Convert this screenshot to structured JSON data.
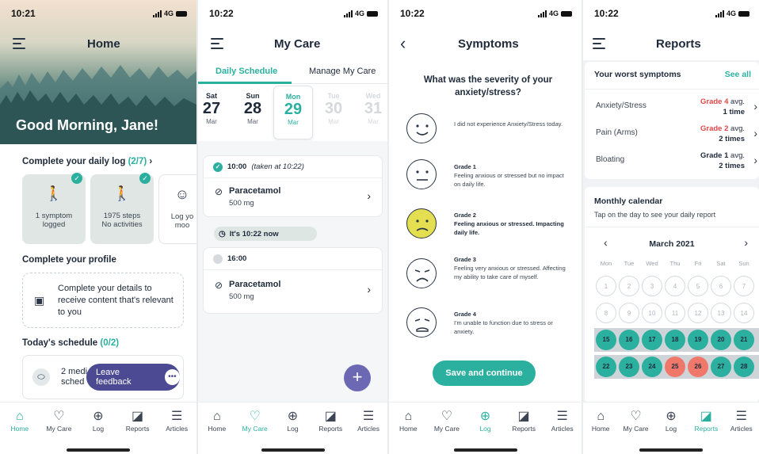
{
  "home": {
    "time": "10:21",
    "signal": "4G",
    "title": "Home",
    "greeting": "Good Morning, Jane!",
    "daily_log_title": "Complete your daily log",
    "daily_log_count": "(2/7)",
    "log_cards": [
      {
        "line1": "1 symptom",
        "line2": "logged"
      },
      {
        "line1": "1975 steps",
        "line2": "No activities"
      },
      {
        "line1": "Log yo",
        "line2": "moo"
      }
    ],
    "profile_title": "Complete your profile",
    "profile_text": "Complete your details to receive content that's relevant to you",
    "schedule_title": "Today's schedule",
    "schedule_count": "(0/2)",
    "schedule_item": "2 medi sched",
    "feedback_label": "Leave feedback"
  },
  "care": {
    "time": "10:22",
    "signal": "4G",
    "title": "My Care",
    "tabs": [
      "Daily Schedule",
      "Manage My Care"
    ],
    "days": [
      {
        "dn": "Sat",
        "dd": "27",
        "dm": "Mar"
      },
      {
        "dn": "Sun",
        "dd": "28",
        "dm": "Mar"
      },
      {
        "dn": "Mon",
        "dd": "29",
        "dm": "Mar"
      },
      {
        "dn": "Tue",
        "dd": "30",
        "dm": "Mar"
      },
      {
        "dn": "Wed",
        "dd": "31",
        "dm": "Mar"
      }
    ],
    "dose1_time": "10:00",
    "dose1_note": "(taken at 10:22)",
    "med_name": "Paracetamol",
    "med_dose": "500 mg",
    "now_label": "It's 10:22 now",
    "dose2_time": "16:00",
    "fab_label": "+"
  },
  "symptoms": {
    "time": "10:22",
    "signal": "4G",
    "title": "Symptoms",
    "question": "What was the severity of your anxiety/stress?",
    "options": [
      {
        "grade": "",
        "text": "I did not experience Anxiety/Stress today."
      },
      {
        "grade": "Grade 1",
        "text": "Feeling anxious or stressed but no impact on daily life."
      },
      {
        "grade": "Grade 2",
        "text": "Feeling anxious or stressed. Impacting daily life."
      },
      {
        "grade": "Grade 3",
        "text": "Feeling very anxious or stressed. Affecting my ability to take care of myself."
      },
      {
        "grade": "Grade 4",
        "text": "I'm unable to function due to stress or anxiety."
      }
    ],
    "selected_index": 2,
    "save_label": "Save and continue"
  },
  "reports": {
    "time": "10:22",
    "signal": "4G",
    "title": "Reports",
    "worst_title": "Your worst symptoms",
    "see_all": "See all",
    "rows": [
      {
        "name": "Anxiety/Stress",
        "grade": "Grade 4",
        "avg": "avg.",
        "times": "1 time",
        "red": true
      },
      {
        "name": "Pain (Arms)",
        "grade": "Grade 2",
        "avg": "avg.",
        "times": "2 times",
        "red": true
      },
      {
        "name": "Bloating",
        "grade": "Grade 1",
        "avg": "avg.",
        "times": "2 times",
        "red": false
      }
    ],
    "monthly_title": "Monthly calendar",
    "monthly_sub": "Tap on the day to see your daily report",
    "month": "March 2021",
    "weekdays": [
      "Mon",
      "Tue",
      "Wed",
      "Thu",
      "Fri",
      "Sat",
      "Sun"
    ],
    "week1": [
      "1",
      "2",
      "3",
      "4",
      "5",
      "6",
      "7"
    ],
    "week2": [
      "8",
      "9",
      "10",
      "11",
      "12",
      "13",
      "14"
    ],
    "week3": [
      "15",
      "16",
      "17",
      "18",
      "19",
      "20",
      "21"
    ],
    "week4": [
      "22",
      "23",
      "24",
      "25",
      "26",
      "27",
      "28"
    ],
    "week4_red": [
      3,
      4
    ]
  },
  "nav": [
    "Home",
    "My Care",
    "Log",
    "Reports",
    "Articles"
  ],
  "colors": {
    "accent": "#2bb0a0",
    "purple": "#4b4a92",
    "red": "#e04848",
    "selected_face": "#e4df50"
  }
}
